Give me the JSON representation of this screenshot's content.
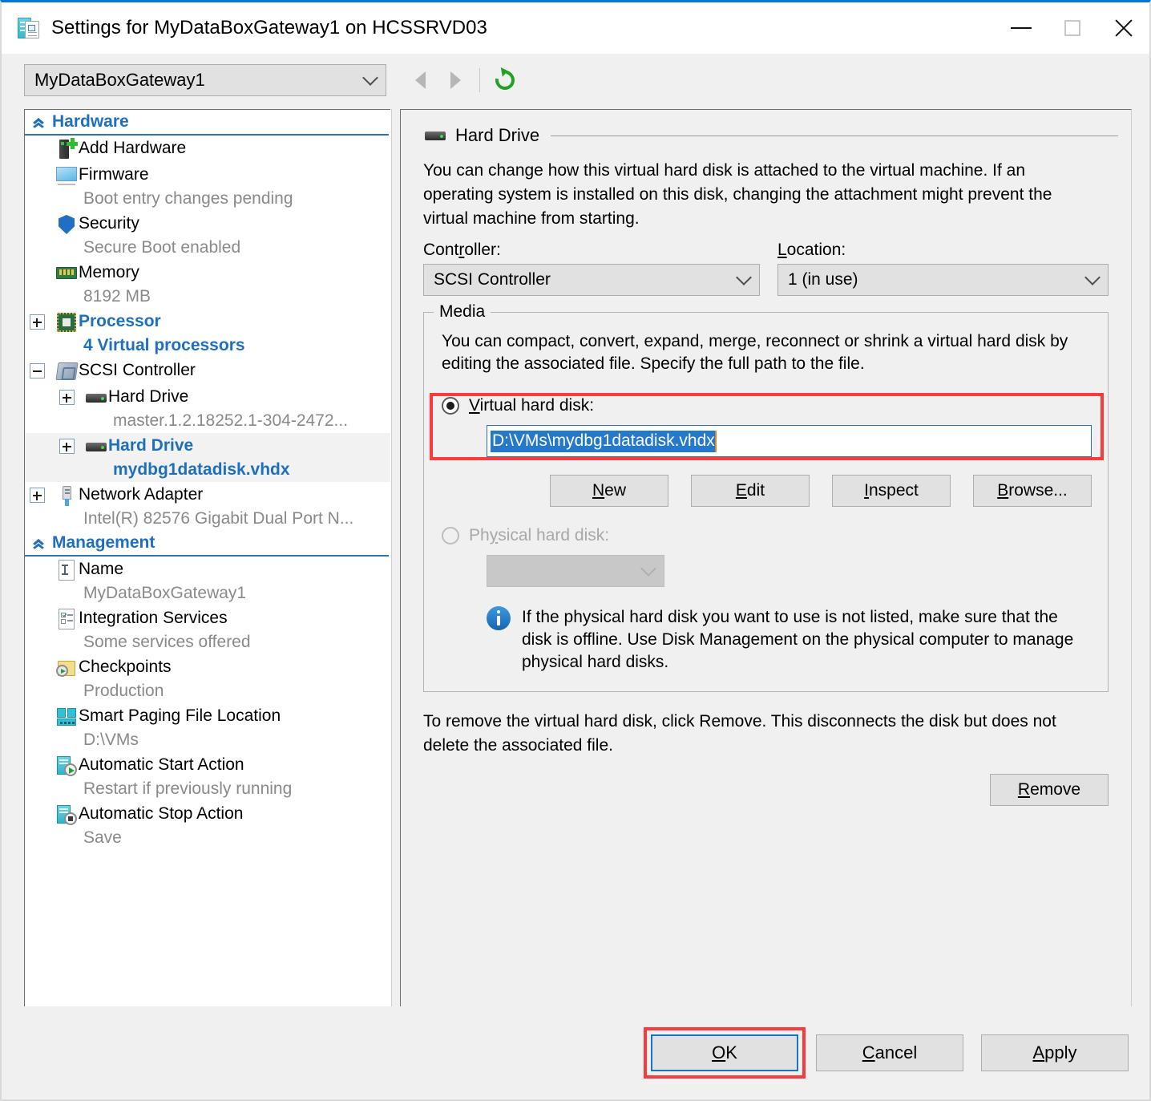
{
  "window": {
    "title": "Settings for MyDataBoxGateway1 on HCSSRVD03",
    "icon": "vm-settings-icon",
    "minimize_label": "Minimize",
    "maximize_label": "Maximize",
    "close_label": "Close"
  },
  "toolbar": {
    "vm_selected": "MyDataBoxGateway1",
    "back_label": "Back",
    "forward_label": "Forward",
    "refresh_label": "Refresh"
  },
  "tree": {
    "sections": [
      {
        "label": "Hardware",
        "items": [
          {
            "title": "Add Hardware",
            "sub": "",
            "icon": "add-hardware-icon",
            "expander": "none",
            "selected": false,
            "bold": false
          },
          {
            "title": "Firmware",
            "sub": "Boot entry changes pending",
            "icon": "firmware-icon",
            "expander": "none",
            "selected": false,
            "bold": false
          },
          {
            "title": "Security",
            "sub": "Secure Boot enabled",
            "icon": "shield-icon",
            "expander": "none",
            "selected": false,
            "bold": false
          },
          {
            "title": "Memory",
            "sub": "8192 MB",
            "icon": "memory-icon",
            "expander": "none",
            "selected": false,
            "bold": false
          },
          {
            "title": "Processor",
            "sub": "4 Virtual processors",
            "icon": "processor-icon",
            "expander": "plus",
            "selected": false,
            "bold": true
          },
          {
            "title": "SCSI Controller",
            "sub": "",
            "icon": "scsi-controller-icon",
            "expander": "minus",
            "selected": false,
            "bold": false
          },
          {
            "title": "Hard Drive",
            "sub": "master.1.2.18252.1-304-2472...",
            "icon": "hard-drive-icon",
            "expander": "plus-indented",
            "selected": false,
            "bold": false
          },
          {
            "title": "Hard Drive",
            "sub": "mydbg1datadisk.vhdx",
            "icon": "hard-drive-icon",
            "expander": "plus-indented",
            "selected": true,
            "bold": true
          },
          {
            "title": "Network Adapter",
            "sub": "Intel(R) 82576 Gigabit Dual Port N...",
            "icon": "network-adapter-icon",
            "expander": "plus",
            "selected": false,
            "bold": false
          }
        ]
      },
      {
        "label": "Management",
        "items": [
          {
            "title": "Name",
            "sub": "MyDataBoxGateway1",
            "icon": "name-icon",
            "expander": "none",
            "selected": false,
            "bold": false
          },
          {
            "title": "Integration Services",
            "sub": "Some services offered",
            "icon": "integration-services-icon",
            "expander": "none",
            "selected": false,
            "bold": false
          },
          {
            "title": "Checkpoints",
            "sub": "Production",
            "icon": "checkpoints-icon",
            "expander": "none",
            "selected": false,
            "bold": false
          },
          {
            "title": "Smart Paging File Location",
            "sub": "D:\\VMs",
            "icon": "smart-paging-icon",
            "expander": "none",
            "selected": false,
            "bold": false
          },
          {
            "title": "Automatic Start Action",
            "sub": "Restart if previously running",
            "icon": "auto-start-icon",
            "expander": "none",
            "selected": false,
            "bold": false
          },
          {
            "title": "Automatic Stop Action",
            "sub": "Save",
            "icon": "auto-stop-icon",
            "expander": "none",
            "selected": false,
            "bold": false
          }
        ]
      }
    ]
  },
  "panel": {
    "title": "Hard Drive",
    "icon": "hard-drive-icon",
    "description": "You can change how this virtual hard disk is attached to the virtual machine. If an operating system is installed on this disk, changing the attachment might prevent the virtual machine from starting.",
    "controller_label": "Controller:",
    "controller_value": "SCSI Controller",
    "location_label": "Location:",
    "location_value": "1 (in use)",
    "media": {
      "legend": "Media",
      "description": "You can compact, convert, expand, merge, reconnect or shrink a virtual hard disk by editing the associated file. Specify the full path to the file.",
      "virtual_radio_label": "Virtual hard disk:",
      "virtual_radio_selected": true,
      "vhd_path": "D:\\VMs\\mydbg1datadisk.vhdx",
      "vhd_path_selected": true,
      "buttons": [
        {
          "label": "New",
          "accel": "N"
        },
        {
          "label": "Edit",
          "accel": "E"
        },
        {
          "label": "Inspect",
          "accel": "I"
        },
        {
          "label": "Browse...",
          "accel": "B"
        }
      ],
      "physical_radio_label": "Physical hard disk:",
      "physical_radio_selected": false,
      "physical_radio_disabled": true,
      "physical_combo_value": "",
      "info_icon": "info-icon",
      "info_text": "If the physical hard disk you want to use is not listed, make sure that the disk is offline. Use Disk Management on the physical computer to manage physical hard disks."
    },
    "remove_note": "To remove the virtual hard disk, click Remove. This disconnects the disk but does not delete the associated file.",
    "remove_button": "Remove",
    "remove_accel": "R"
  },
  "footer": {
    "ok": "OK",
    "ok_accel": "O",
    "cancel": "Cancel",
    "cancel_accel": "C",
    "apply": "Apply",
    "apply_accel": "A"
  },
  "annotations": {
    "highlight_color": "#fb3b3b",
    "targets": [
      "virtual-hard-disk-field",
      "ok-button"
    ]
  }
}
